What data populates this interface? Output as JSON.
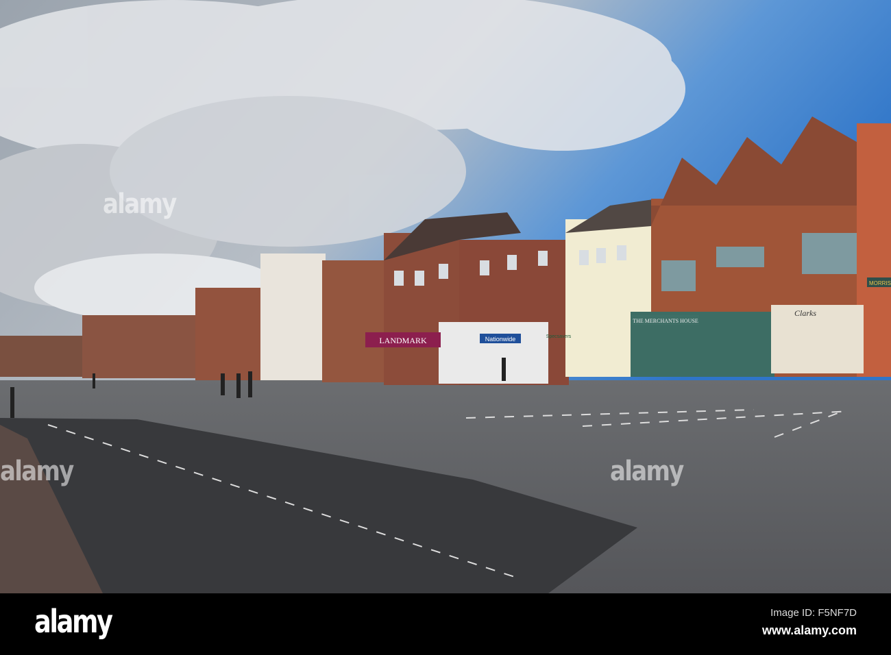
{
  "photo": {
    "signs": {
      "landmark": "LANDMARK",
      "merchants_house": "THE MERCHANTS HOUSE",
      "clarks": "Clarks",
      "morrisons": "MORRISO",
      "nationwide": "Nationwide",
      "specsavers": "Specsavers"
    },
    "watermark": "alamy"
  },
  "footer": {
    "logo": "alamy",
    "image_id": "Image ID: F5NF7D",
    "url": "www.alamy.com"
  },
  "colors": {
    "sky": "#3f82d0",
    "road": "#4b4c4f",
    "brick": "#8b4a36"
  }
}
